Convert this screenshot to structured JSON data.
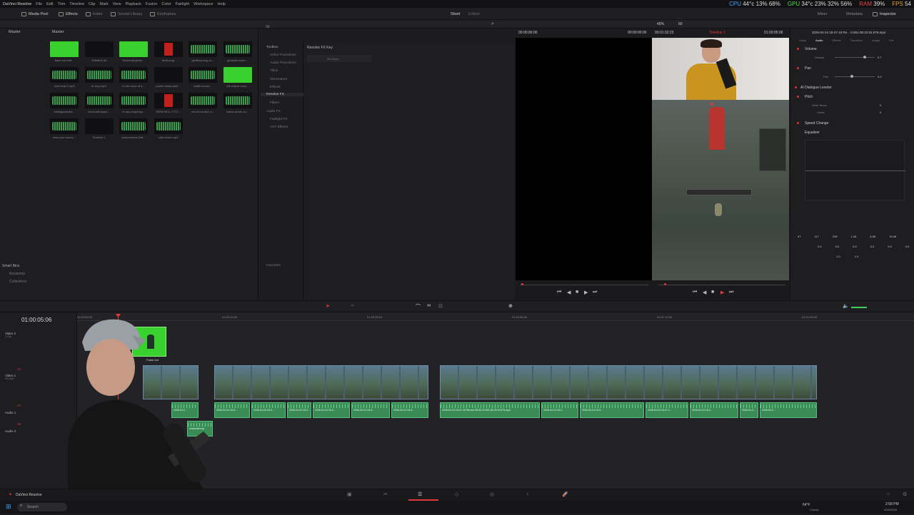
{
  "menu": {
    "app": "DaVinci Resolve",
    "items": [
      "File",
      "Edit",
      "Trim",
      "Timeline",
      "Clip",
      "Mark",
      "View",
      "Playback",
      "Fusion",
      "Color",
      "Fairlight",
      "Workspace",
      "Help"
    ]
  },
  "stats": {
    "cpu": "CPU",
    "cpu_temp": "44°c",
    "cpu_pct": "13%",
    "cpu_mem": "68%",
    "gpu": "GPU",
    "gpu_temp": "34°c",
    "gpu_pct": "23%",
    "gpu_mem": "32%",
    "gpu_x": "56%",
    "ram": "RAM",
    "ram_pct": "39%",
    "fps": "FPS",
    "fps_val": "54"
  },
  "toolbar": {
    "media_pool": "Media Pool",
    "effects": "Effects",
    "index": "Index",
    "sound_library": "Sound Library",
    "keyframes": "Keyframes",
    "short": "Short",
    "edited": "Edited",
    "mixer": "Mixer",
    "metadata": "Metadata",
    "inspector": "Inspector"
  },
  "mediapool": {
    "tab_master": "Master",
    "tab_master2": "Master",
    "clips": [
      {
        "label": "frase bot that..."
      },
      {
        "label": "00ffa3c5.aif"
      },
      {
        "label": "Minecraft green..."
      },
      {
        "label": "thinki.png"
      },
      {
        "label": "geoffrey-king-m..."
      },
      {
        "label": "grenade-explo..."
      },
      {
        "label": "heat-beat-2.mp3"
      },
      {
        "label": "er-drip-mp3"
      },
      {
        "label": "in the voice of a..."
      },
      {
        "label": "power-metal-pale..."
      },
      {
        "label": "battle-sound..."
      },
      {
        "label": "will-wayne-crow..."
      },
      {
        "label": "metalgearsolid..."
      },
      {
        "label": "minecraft-explo..."
      },
      {
        "label": "er-spy-sniperlay..."
      },
      {
        "label": "NEW HELL Y-TU..."
      },
      {
        "label": "record scratch-s..."
      },
      {
        "label": "roblox-death-so..."
      },
      {
        "label": "airso-dsc-sound..."
      },
      {
        "label": "Timeline 1"
      },
      {
        "label": "downloaders-bell..."
      },
      {
        "label": "vine-boom.mp3"
      }
    ],
    "smart_bins": "Smart Bins",
    "keywords": "Keywords",
    "collections": "Collections"
  },
  "effects": {
    "search_title": "3d",
    "tree": [
      "Toolbox",
      "Video Transitions",
      "Audio Transitions",
      "Titles",
      "Generators",
      "Effects",
      "Resolve FX",
      "Filters",
      "Audio FX",
      "Fairlight FX",
      "VST Effects"
    ],
    "favorites": "Favorites",
    "list_header": "Resolve FX Key",
    "list_item": "3D Keyer"
  },
  "viewer": {
    "tc_left": "00:00:00:00",
    "tc_src": "00:00:00:00",
    "tc_dur": "00:01:32:23",
    "timeline_name": "Timeline 1",
    "tc_right": "01:00:05:06",
    "zoom": "40%",
    "frame": "60"
  },
  "inspector": {
    "filename": "2026-04-24 18-37-18 Re... 0.551-08.23.02.879.mp4",
    "tabs": [
      "Video",
      "Audio",
      "Effects",
      "Transition",
      "Image",
      "File"
    ],
    "volume": "Volume",
    "volume_sub": "Volume",
    "volume_val": "0.7",
    "pan": "Pan",
    "pan_sub": "Pan",
    "pan_val": "0.0",
    "dialogue": "AI Dialogue Leveler",
    "pitch": "Pitch",
    "semitones": "Semi Tones",
    "semitones_val": "0",
    "cents": "Cents",
    "cents_val": "0",
    "speed": "Speed Change",
    "equalizer": "Equalizer",
    "eq_vals": [
      "97",
      "117",
      "239",
      "1.26",
      "6.06",
      "19.06"
    ],
    "eq_vals2": [
      "0.0",
      "0.0",
      "0.0",
      "0.0",
      "0.0",
      "0.0"
    ],
    "eq_vals3": [
      "1.0",
      "1.0"
    ]
  },
  "timeline": {
    "timecode": "01:00:05:06",
    "ruler": [
      "01:00:00:00",
      "01:00:16:00",
      "01:00:36:00",
      "01:00:56:00",
      "01:01:12:00",
      "01:01:28:00"
    ],
    "tracks": {
      "v2": "Video 2",
      "v2_sub": "1 Clip",
      "v1": "Video 1",
      "v1_sub": "23 Clips",
      "a1": "Audio 1",
      "a2": "Audio 2",
      "v1_tag": "V1",
      "a1_tag": "A1",
      "a2_tag": "A2"
    },
    "clip_title": "Frase bot",
    "audio_caps": [
      "2026-04-2...",
      "2026-04-24 18-3...",
      "2026-04-24 18-3...",
      "2026-04-24 18-37-18 Record 08.06.20.551-08.23.02.879.mp4",
      "2026-04-24 18-3...",
      "2026-04-24 18-37-1...",
      "2026-04-24 18-3...",
      "2026-04-2..."
    ],
    "a2_cap": "minecraft-exp..."
  },
  "taskbar": {
    "app": "DaVinci Resolve",
    "search": "Search",
    "weather_temp": "64°F",
    "weather": "Cloudy",
    "time": "2:58 PM",
    "date": "4/25/2026"
  },
  "colors": {
    "accent": "#e03a3a",
    "audio": "#3a8b55",
    "video": "#4a5f6e",
    "green": "#39d12d"
  }
}
